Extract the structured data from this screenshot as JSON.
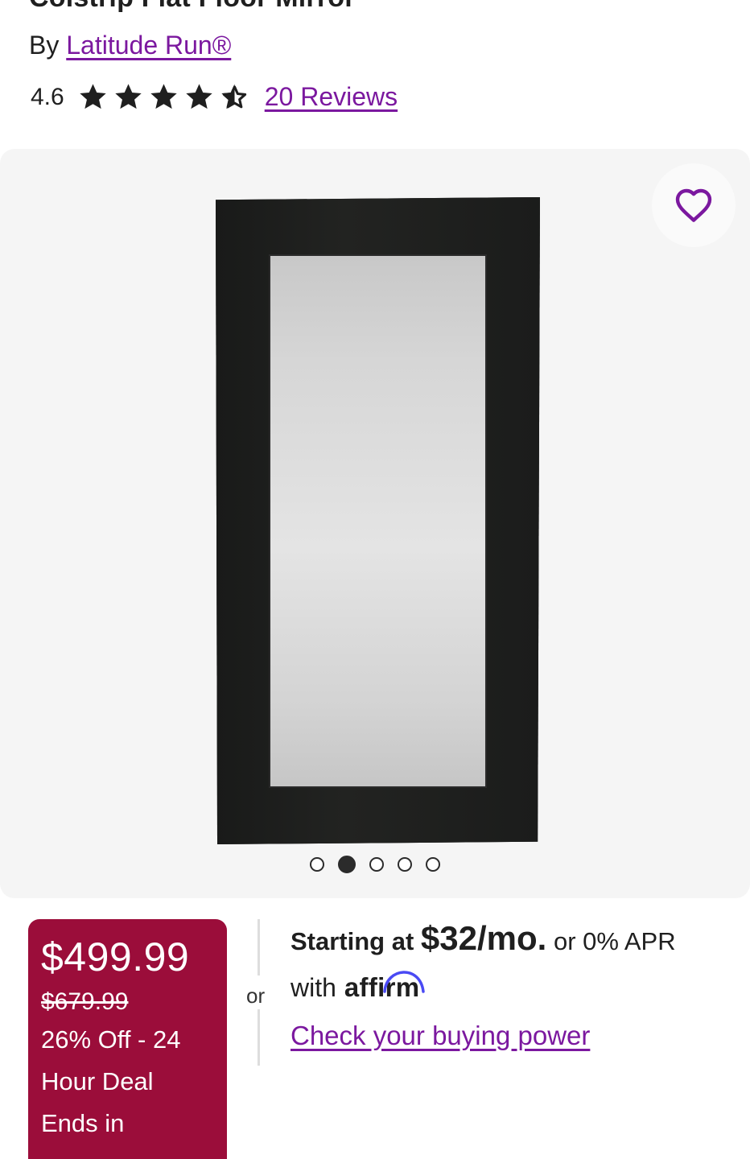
{
  "product": {
    "title": "Colstrip Flat Floor Mirror",
    "by_prefix": "By",
    "brand": "Latitude Run®"
  },
  "rating": {
    "score": "4.6",
    "stars_value": 4.6,
    "stars_max": 5,
    "reviews_label": "20 Reviews"
  },
  "gallery": {
    "total_images": 5,
    "active_index": 2
  },
  "price": {
    "current": "$499.99",
    "original": "$679.99",
    "deal_text": "26% Off - 24 Hour Deal Ends in"
  },
  "financing": {
    "or_label": "or",
    "starting": "Starting at",
    "amount": "$32/mo.",
    "apr_text": "or 0% APR",
    "with_text": "with",
    "provider": "affirm",
    "check_link": "Check your buying power"
  },
  "colors": {
    "link": "#7b189f",
    "price_bg": "#9b0d3a",
    "gallery_bg": "#f5f5f5"
  },
  "icons": {
    "favorite": "heart-outline-icon",
    "star": "star-icon",
    "half_star": "star-half-icon"
  }
}
